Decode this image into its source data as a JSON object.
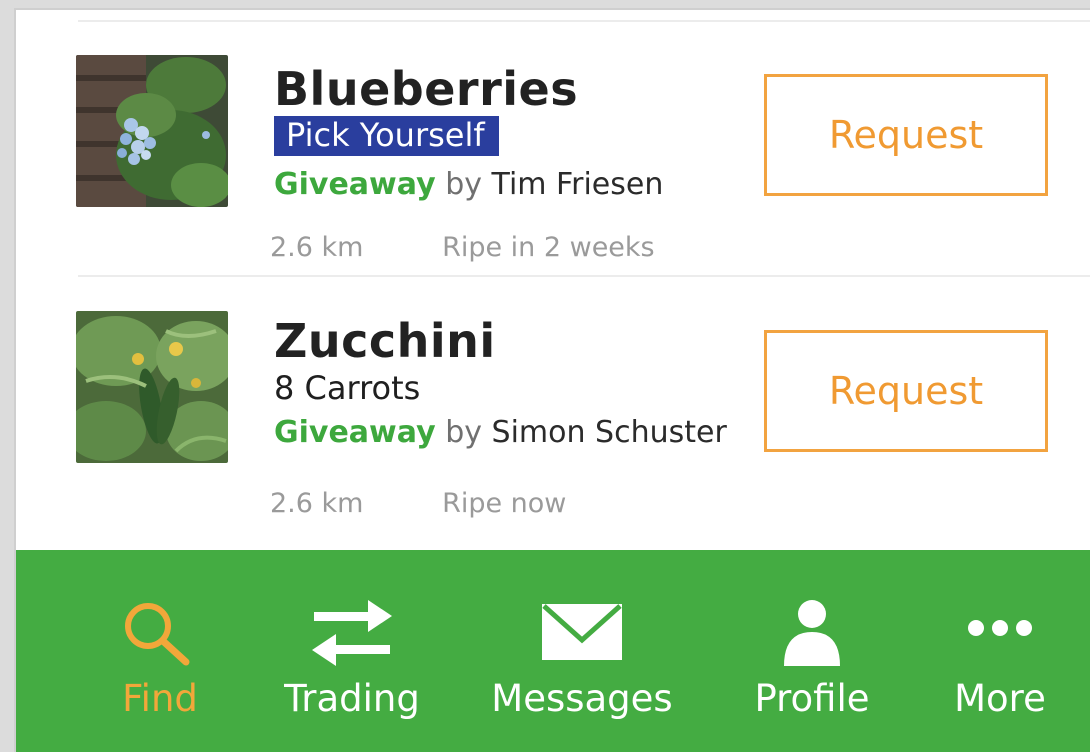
{
  "listings": [
    {
      "title": "Blueberries",
      "subtitle": "Pick Yourself",
      "subtitle_highlighted": true,
      "type": "Giveaway",
      "by_word": "by",
      "owner": "Tim Friesen",
      "distance": "2.6 km",
      "ripeness": "Ripe in 2 weeks",
      "action_label": "Request",
      "thumb_icon": "blueberry-photo"
    },
    {
      "title": "Zucchini",
      "subtitle": "8 Carrots",
      "subtitle_highlighted": false,
      "type": "Giveaway",
      "by_word": "by",
      "owner": "Simon Schuster",
      "distance": "2.6 km",
      "ripeness": "Ripe now",
      "action_label": "Request",
      "thumb_icon": "zucchini-photo"
    }
  ],
  "tabbar": {
    "tabs": [
      {
        "label": "Find",
        "icon": "search-icon",
        "active": true
      },
      {
        "label": "Trading",
        "icon": "swap-arrows-icon",
        "active": false
      },
      {
        "label": "Messages",
        "icon": "envelope-icon",
        "active": false
      },
      {
        "label": "Profile",
        "icon": "person-icon",
        "active": false
      },
      {
        "label": "More",
        "icon": "more-dots-icon",
        "active": false
      }
    ]
  },
  "colors": {
    "accent_orange": "#f09a32",
    "tabbar_green": "#44ac42",
    "giveaway_green": "#3da83d",
    "highlight_blue": "#2a3e9e"
  }
}
